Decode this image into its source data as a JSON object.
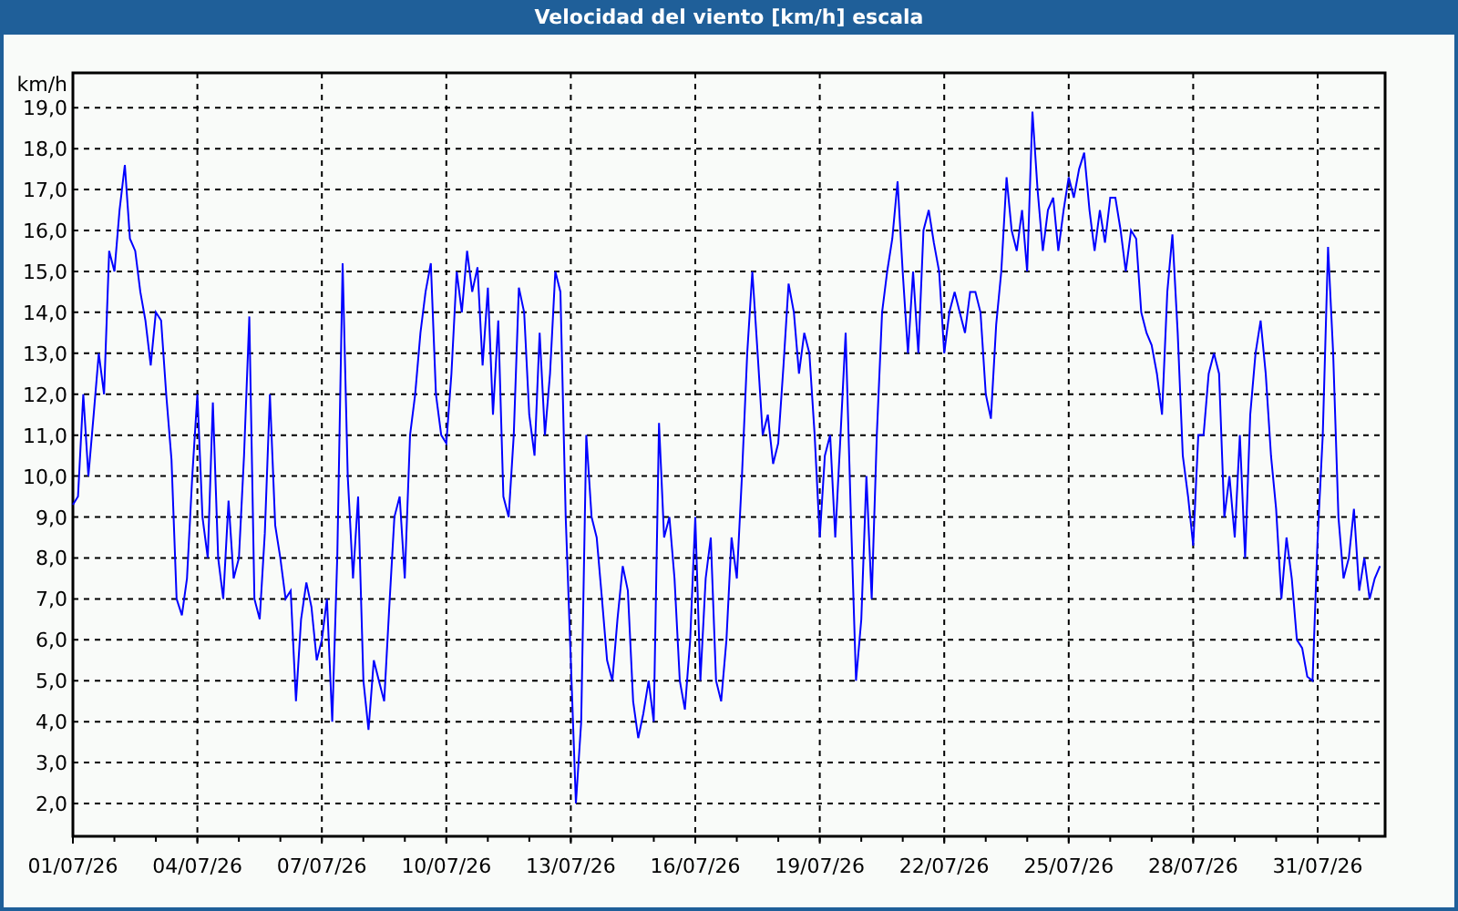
{
  "window": {
    "title": "Velocidad del viento [km/h] escala"
  },
  "chart": {
    "chart_data": {
      "type": "line",
      "ylabel": "km/h",
      "grid": true,
      "ylim": [
        1.2,
        19.85
      ],
      "yticks": [
        {
          "value": 19,
          "label": "19,0"
        },
        {
          "value": 18,
          "label": "18,0"
        },
        {
          "value": 17,
          "label": "17,0"
        },
        {
          "value": 16,
          "label": "16,0"
        },
        {
          "value": 15,
          "label": "15,0"
        },
        {
          "value": 14,
          "label": "14,0"
        },
        {
          "value": 13,
          "label": "13,0"
        },
        {
          "value": 12,
          "label": "12,0"
        },
        {
          "value": 11,
          "label": "11,0"
        },
        {
          "value": 10,
          "label": "10,0"
        },
        {
          "value": 9,
          "label": "9,0"
        },
        {
          "value": 8,
          "label": "8,0"
        },
        {
          "value": 7,
          "label": "7,0"
        },
        {
          "value": 6,
          "label": "6,0"
        },
        {
          "value": 5,
          "label": "5,0"
        },
        {
          "value": 4,
          "label": "4,0"
        },
        {
          "value": 3,
          "label": "3,0"
        },
        {
          "value": 2,
          "label": "2,0"
        }
      ],
      "categories": [
        "01/07/26",
        null,
        null,
        null,
        null,
        null,
        null,
        null,
        null,
        null,
        null,
        null,
        null,
        null,
        null,
        null,
        null,
        null,
        null,
        null,
        null,
        null,
        null,
        null,
        "04/07/26",
        null,
        null,
        null,
        null,
        null,
        null,
        null,
        null,
        null,
        null,
        null,
        null,
        null,
        null,
        null,
        null,
        null,
        null,
        null,
        null,
        null,
        null,
        null,
        "07/07/26",
        null,
        null,
        null,
        null,
        null,
        null,
        null,
        null,
        null,
        null,
        null,
        null,
        null,
        null,
        null,
        null,
        null,
        null,
        null,
        null,
        null,
        null,
        null,
        "10/07/26",
        null,
        null,
        null,
        null,
        null,
        null,
        null,
        null,
        null,
        null,
        null,
        null,
        null,
        null,
        null,
        null,
        null,
        null,
        null,
        null,
        null,
        null,
        null,
        "13/07/26",
        null,
        null,
        null,
        null,
        null,
        null,
        null,
        null,
        null,
        null,
        null,
        null,
        null,
        null,
        null,
        null,
        null,
        null,
        null,
        null,
        null,
        null,
        null,
        "16/07/26",
        null,
        null,
        null,
        null,
        null,
        null,
        null,
        null,
        null,
        null,
        null,
        null,
        null,
        null,
        null,
        null,
        null,
        null,
        null,
        null,
        null,
        null,
        null,
        "19/07/26",
        null,
        null,
        null,
        null,
        null,
        null,
        null,
        null,
        null,
        null,
        null,
        null,
        null,
        null,
        null,
        null,
        null,
        null,
        null,
        null,
        null,
        null,
        null,
        "22/07/26",
        null,
        null,
        null,
        null,
        null,
        null,
        null,
        null,
        null,
        null,
        null,
        null,
        null,
        null,
        null,
        null,
        null,
        null,
        null,
        null,
        null,
        null,
        null,
        "25/07/26",
        null,
        null,
        null,
        null,
        null,
        null,
        null,
        null,
        null,
        null,
        null,
        null,
        null,
        null,
        null,
        null,
        null,
        null,
        null,
        null,
        null,
        null,
        null,
        "28/07/26",
        null,
        null,
        null,
        null,
        null,
        null,
        null,
        null,
        null,
        null,
        null,
        null,
        null,
        null,
        null,
        null,
        null,
        null,
        null,
        null,
        null,
        null,
        null,
        "31/07/26",
        null,
        null,
        null,
        null,
        null,
        null,
        null,
        null,
        null,
        null,
        null,
        null
      ],
      "series": [
        {
          "color": "#0000ff",
          "values": [
            9.3,
            9.5,
            12,
            10,
            11.5,
            13,
            12,
            15.5,
            15,
            16.5,
            17.6,
            15.8,
            15.5,
            14.5,
            13.8,
            12.7,
            14,
            13.8,
            12,
            10.4,
            7,
            6.6,
            7.5,
            10,
            12,
            9,
            8,
            11.8,
            8,
            7,
            9.4,
            7.5,
            8,
            10.5,
            13.9,
            7,
            6.5,
            8.6,
            12,
            8.8,
            8,
            7,
            7.2,
            4.5,
            6.5,
            7.4,
            6.8,
            5.5,
            6,
            7,
            4,
            8.1,
            15.2,
            10,
            7.5,
            9.5,
            5,
            3.8,
            5.5,
            5,
            4.5,
            6.8,
            9,
            9.5,
            7.5,
            11,
            12,
            13.5,
            14.5,
            15.2,
            12,
            11,
            10.8,
            12.5,
            15,
            14,
            15.5,
            14.5,
            15.1,
            12.7,
            14.6,
            11.5,
            13.8,
            9.5,
            9,
            11,
            14.6,
            14,
            11.5,
            10.5,
            13.5,
            11,
            12.5,
            15,
            14.5,
            9,
            5.5,
            2,
            4,
            11,
            9,
            8.5,
            7,
            5.5,
            5,
            6.5,
            7.8,
            7.2,
            4.5,
            3.6,
            4.2,
            5,
            4,
            11.3,
            8.5,
            9,
            7.5,
            5,
            4.3,
            6,
            9,
            5,
            7.5,
            8.5,
            5,
            4.5,
            6,
            8.5,
            7.5,
            10,
            13,
            15,
            13,
            11,
            11.5,
            10.3,
            10.8,
            12.7,
            14.7,
            14,
            12.5,
            13.5,
            13,
            11,
            8.5,
            10.5,
            11,
            8.5,
            11,
            13.5,
            9,
            5,
            6.5,
            10,
            7,
            11,
            14,
            15,
            15.8,
            17.2,
            15,
            13,
            15,
            13,
            16,
            16.5,
            15.7,
            15,
            13,
            14,
            14.5,
            14,
            13.5,
            14.5,
            14.5,
            14,
            12,
            11.4,
            13.7,
            15,
            17.3,
            16,
            15.5,
            16.5,
            15,
            18.9,
            17,
            15.5,
            16.5,
            16.8,
            15.5,
            16.5,
            17.3,
            16.8,
            17.5,
            17.9,
            16.5,
            15.5,
            16.5,
            15.7,
            16.8,
            16.8,
            16,
            15,
            16,
            15.8,
            14,
            13.5,
            13.2,
            12.5,
            11.5,
            14.5,
            15.9,
            13.5,
            10.5,
            9.5,
            8.3,
            11,
            11,
            12.5,
            13,
            12.5,
            9,
            10,
            8.5,
            11,
            8,
            11.5,
            13,
            13.8,
            12.5,
            10.5,
            9.2,
            7,
            8.5,
            7.5,
            6,
            5.8,
            5.1,
            5,
            8.5,
            11,
            15.6,
            13,
            9,
            7.5,
            8,
            9.2,
            7.2,
            8,
            7,
            7.5,
            7.8
          ]
        }
      ]
    }
  }
}
